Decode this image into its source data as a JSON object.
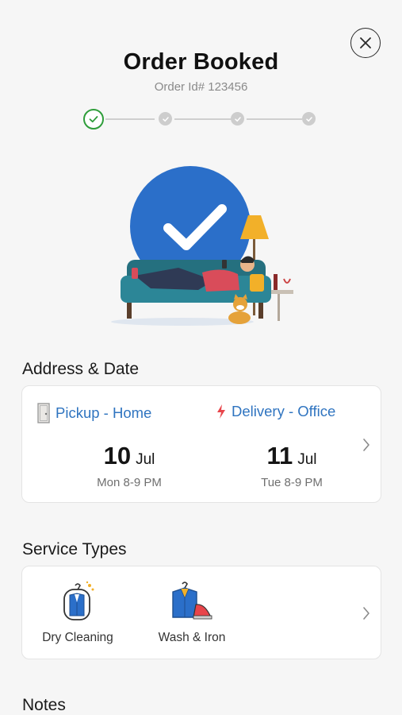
{
  "header": {
    "title": "Order Booked",
    "order_id": "Order Id# 123456",
    "progress": {
      "current_step": 1,
      "total_steps": 4
    }
  },
  "icons": {
    "close": "close-icon",
    "check": "check-icon",
    "pickup": "door-icon",
    "delivery": "lightning-icon",
    "chevron": "chevron-right-icon",
    "dry_cleaning": "suit-bag-icon",
    "wash_iron": "shirt-iron-icon"
  },
  "colors": {
    "accent_blue": "#2f74c0",
    "success_green": "#2e9d3a",
    "delivery_red": "#e8454b",
    "illustration_blue": "#2b6fc9"
  },
  "address_date": {
    "section_title": "Address & Date",
    "pickup": {
      "label": "Pickup - Home",
      "day": "10",
      "month": "Jul",
      "slot": "Mon 8-9 PM"
    },
    "delivery": {
      "label": "Delivery - Office",
      "day": "11",
      "month": "Jul",
      "slot": "Tue 8-9 PM"
    }
  },
  "service_types": {
    "section_title": "Service Types",
    "items": [
      {
        "label": "Dry Cleaning",
        "icon": "suit-bag-icon"
      },
      {
        "label": "Wash & Iron",
        "icon": "shirt-iron-icon"
      }
    ]
  },
  "notes": {
    "section_title": "Notes"
  }
}
